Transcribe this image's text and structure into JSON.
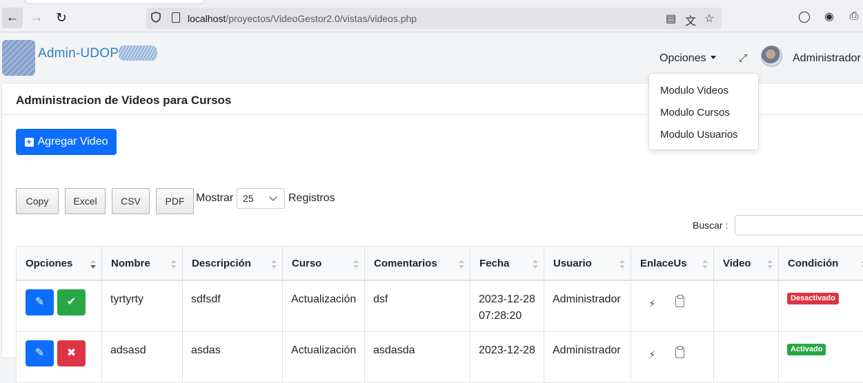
{
  "browser": {
    "url_host": "localhost",
    "url_path": "/proyectos/VideoGestor2.0/vistas/videos.php"
  },
  "header": {
    "brand": "Admin-UDOP",
    "menu_label": "Opciones",
    "user_name": "Administrador"
  },
  "dropdown": {
    "items": [
      "Modulo Videos",
      "Modulo Cursos",
      "Modulo Usuarios"
    ]
  },
  "card": {
    "title": "Administracion de Videos para Cursos",
    "add_button": "Agregar Video"
  },
  "toolbar": {
    "export_buttons": [
      "Copy",
      "Excel",
      "CSV",
      "PDF"
    ],
    "show_label": "Mostrar",
    "page_size": "25",
    "records_label": "Registros",
    "search_label": "Buscar :"
  },
  "table": {
    "columns": [
      "Opciones",
      "Nombre",
      "Descripción",
      "Curso",
      "Comentarios",
      "Fecha",
      "Usuario",
      "EnlaceUs",
      "Video",
      "Condición"
    ],
    "rows": [
      {
        "nombre": "tyrtyrty",
        "descripcion": "sdfsdf",
        "curso": "Actualización",
        "comentarios": "dsf",
        "fecha_date": "2023-12-28",
        "fecha_time": "07:28:20",
        "usuario": "Administrador",
        "video": "",
        "condicion": "Desactivado"
      },
      {
        "nombre": "adsasd",
        "descripcion": "asdas",
        "curso": "Actualización",
        "comentarios": "asdasda",
        "fecha_date": "2023-12-28",
        "fecha_time": "",
        "usuario": "Administrador",
        "video": "",
        "condicion": "Activado"
      }
    ]
  },
  "colors": {
    "primary": "#0d6efd",
    "success": "#28a745",
    "danger": "#dc3545",
    "brand": "#2f7dc4"
  }
}
